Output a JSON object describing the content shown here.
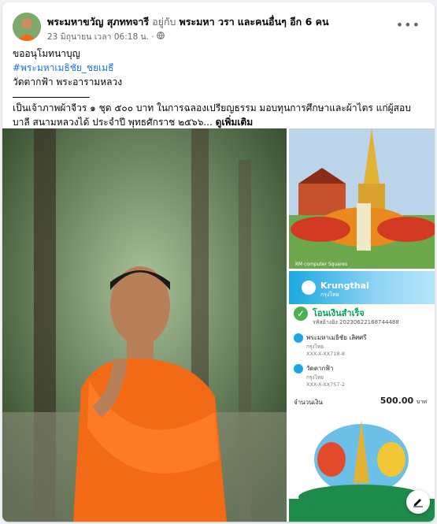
{
  "post": {
    "author": "พระมหาขวัญ สุภททจารี",
    "with_word": "อยู่กับ",
    "tagged": "พระมหา วรา",
    "and_others": "และคนอื่นๆ อีก 6 คน",
    "date": "23 มิถุนายน เวลา 06:18 น.",
    "dot": "·",
    "privacy_icon": "globe-icon",
    "more_icon": "more-options-icon"
  },
  "body": {
    "line1": "ขออนุโมทนาบุญ",
    "hashtag": "#พระมหาเมธิชัย_ชยเมธี",
    "line3": "วัดตากฟ้า พระอารามหลวง",
    "line4": "เป็นเจ้าภาพผ้าจีวร ๑ ชุด ๕๐๐ บาท ในการฉลองเปรียญธรรม มอบทุนการศึกษาและผ้าไตร แก่ผู้สอบบาลี สนามหลวงได้ ประจำปี พุทธศักราช ๒๕๖๖...",
    "see_more": "ดูเพิ่มเติม"
  },
  "photos": {
    "temple_caption": "KM computer Squares",
    "receipt": {
      "bank": "Krungthai",
      "bank_sub": "กรุงไทย",
      "status": "โอนเงินสำเร็จ",
      "ref": "รหัสอ้างอิง 20230622168744488",
      "from_name": "พระมหาเมธิชัย เลิศศรี",
      "from_bank": "กรุงไทย",
      "from_acct": "XXX-X-XX718-8",
      "to_name": "วัดตากฟ้า",
      "to_bank": "กรุงไทย",
      "to_acct": "XXX-X-XX757-2",
      "amount_label": "จำนวนเงิน",
      "amount": "500.00",
      "currency": "บาท"
    },
    "edit_icon": "edit-icon"
  },
  "colors": {
    "link": "#216fdb",
    "robe": "#f26a16",
    "success": "#00a651"
  }
}
